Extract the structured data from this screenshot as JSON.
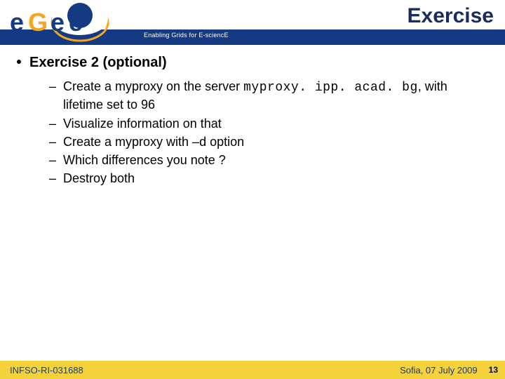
{
  "header": {
    "logo_text_main": "eGee",
    "tagline": "Enabling Grids for E-sciencE",
    "slide_title": "Exercise"
  },
  "content": {
    "heading": "Exercise 2 (optional)",
    "bullets": [
      {
        "pre": "Create a myproxy on the server ",
        "mono": "myproxy. ipp. acad. bg",
        "post": ", with lifetime set to 96"
      },
      {
        "pre": "Visualize information on that",
        "mono": "",
        "post": ""
      },
      {
        "pre": "Create a myproxy with –d option",
        "mono": "",
        "post": ""
      },
      {
        "pre": "Which differences you note ?",
        "mono": "",
        "post": ""
      },
      {
        "pre": "Destroy both",
        "mono": "",
        "post": ""
      }
    ]
  },
  "footer": {
    "left": "INFSO-RI-031688",
    "right": "Sofia, 07 July 2009",
    "page": "13"
  },
  "colors": {
    "brand_blue": "#143a84",
    "accent_yellow": "#f3d23c",
    "logo_orange": "#f7a51c"
  }
}
